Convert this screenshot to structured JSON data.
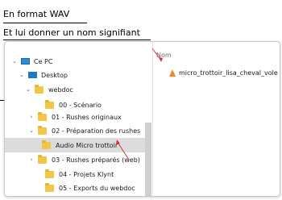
{
  "captions": {
    "line1": "En format WAV",
    "line2": "Et lui donner un nom signifiant"
  },
  "tree": [
    {
      "label": "Ce PC",
      "icon": "computer-icon",
      "chevron": "expanded"
    },
    {
      "label": "Desktop",
      "icon": "desktop-icon",
      "chevron": "expanded"
    },
    {
      "label": "webdoc",
      "icon": "folder-icon",
      "chevron": "expanded"
    },
    {
      "label": "00 - Scénario",
      "icon": "folder-icon",
      "chevron": "none"
    },
    {
      "label": "01 - Rushes originaux",
      "icon": "folder-icon",
      "chevron": "collapsed"
    },
    {
      "label": "02 - Préparation des rushes",
      "icon": "folder-icon",
      "chevron": "expanded"
    },
    {
      "label": "Audio Micro trottoir",
      "icon": "folder-icon",
      "chevron": "none",
      "selected": true
    },
    {
      "label": "03 - Rushes préparés (web)",
      "icon": "folder-icon",
      "chevron": "collapsed"
    },
    {
      "label": "04 - Projets Klynt",
      "icon": "folder-icon",
      "chevron": "none"
    },
    {
      "label": "05 - Exports du webdoc",
      "icon": "folder-icon",
      "chevron": "none"
    }
  ],
  "content": {
    "column_header": "Nom",
    "file_name": "micro_trottoir_lisa_cheval_vole"
  },
  "colors": {
    "folder": "#f3c648",
    "selection": "#dcdcdc",
    "annotation_arrow": "#d9303c",
    "vlc_cone": "#f08a1c"
  }
}
